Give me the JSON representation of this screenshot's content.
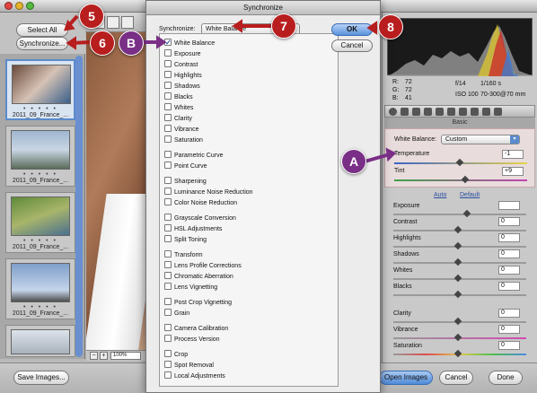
{
  "app": {
    "toolbar_buttons": {
      "select_all": "Select All",
      "synchronize": "Synchronize..."
    }
  },
  "filmstrip": {
    "thumbnails": [
      {
        "filename": "2011_09_France_...",
        "dots": "• • • • •",
        "selected": true
      },
      {
        "filename": "2011_09_France_...",
        "dots": "• • • • •"
      },
      {
        "filename": "2011_09_France_...",
        "dots": "• • • • •"
      },
      {
        "filename": "2011_09_France_...",
        "dots": "• • • • •"
      },
      {
        "filename": "",
        "dots": ""
      }
    ]
  },
  "status_bar": {
    "zoom": "100%",
    "minus": "−",
    "plus": "+"
  },
  "info": {
    "r_label": "R:",
    "r_value": "72",
    "g_label": "G:",
    "g_value": "72",
    "b_label": "B:",
    "b_value": "41",
    "aperture": "f/14",
    "shutter": "1/160 s",
    "iso": "ISO 100",
    "lens": "70-300@70 mm"
  },
  "basic_panel": {
    "header": "Basic",
    "white_balance_label": "White Balance:",
    "white_balance_value": "Custom",
    "temperature_label": "Temperature",
    "temperature_value": "-1",
    "tint_label": "Tint",
    "tint_value": "+9",
    "auto_link": "Auto",
    "default_link": "Default",
    "sliders": [
      {
        "label": "Exposure",
        "value": ""
      },
      {
        "label": "Contrast",
        "value": "0"
      },
      {
        "label": "Highlights",
        "value": "0"
      },
      {
        "label": "Shadows",
        "value": "0"
      },
      {
        "label": "Whites",
        "value": "0"
      },
      {
        "label": "Blacks",
        "value": "0"
      },
      {
        "label": "Clarity",
        "value": "0"
      },
      {
        "label": "Vibrance",
        "value": "0"
      },
      {
        "label": "Saturation",
        "value": "0"
      }
    ]
  },
  "dialog": {
    "title": "Synchronize",
    "synchronize_label": "Synchronize:",
    "synchronize_value": "White Balance",
    "ok": "OK",
    "cancel": "Cancel",
    "items": [
      {
        "label": "White Balance",
        "checked": true
      },
      {
        "label": "Exposure",
        "checked": false
      },
      {
        "label": "Contrast",
        "checked": false
      },
      {
        "label": "Highlights",
        "checked": false
      },
      {
        "label": "Shadows",
        "checked": false
      },
      {
        "label": "Blacks",
        "checked": false
      },
      {
        "label": "Whites",
        "checked": false
      },
      {
        "label": "Clarity",
        "checked": false
      },
      {
        "label": "Vibrance",
        "checked": false
      },
      {
        "label": "Saturation",
        "checked": false
      },
      {
        "label": "Parametric Curve",
        "checked": false
      },
      {
        "label": "Point Curve",
        "checked": false
      },
      {
        "label": "Sharpening",
        "checked": false
      },
      {
        "label": "Luminance Noise Reduction",
        "checked": false
      },
      {
        "label": "Color Noise Reduction",
        "checked": false
      },
      {
        "label": "Grayscale Conversion",
        "checked": false
      },
      {
        "label": "HSL Adjustments",
        "checked": false
      },
      {
        "label": "Split Toning",
        "checked": false
      },
      {
        "label": "Transform",
        "checked": false
      },
      {
        "label": "Lens Profile Corrections",
        "checked": false
      },
      {
        "label": "Chromatic Aberration",
        "checked": false
      },
      {
        "label": "Lens Vignetting",
        "checked": false
      },
      {
        "label": "Post Crop Vignetting",
        "checked": false
      },
      {
        "label": "Grain",
        "checked": false
      },
      {
        "label": "Camera Calibration",
        "checked": false
      },
      {
        "label": "Process Version",
        "checked": false
      },
      {
        "label": "Crop",
        "checked": false
      },
      {
        "label": "Spot Removal",
        "checked": false
      },
      {
        "label": "Local Adjustments",
        "checked": false
      }
    ]
  },
  "bottom_bar": {
    "save_images": "Save Images...",
    "open_images": "Open Images",
    "cancel": "Cancel",
    "done": "Done"
  },
  "callouts": {
    "five": "5",
    "six": "6",
    "seven": "7",
    "eight": "8",
    "b": "B",
    "a": "A"
  },
  "colors": {
    "callout_red": "#b81e1e",
    "callout_purple": "#7a2f86",
    "selection_blue": "#5b8bcc"
  }
}
